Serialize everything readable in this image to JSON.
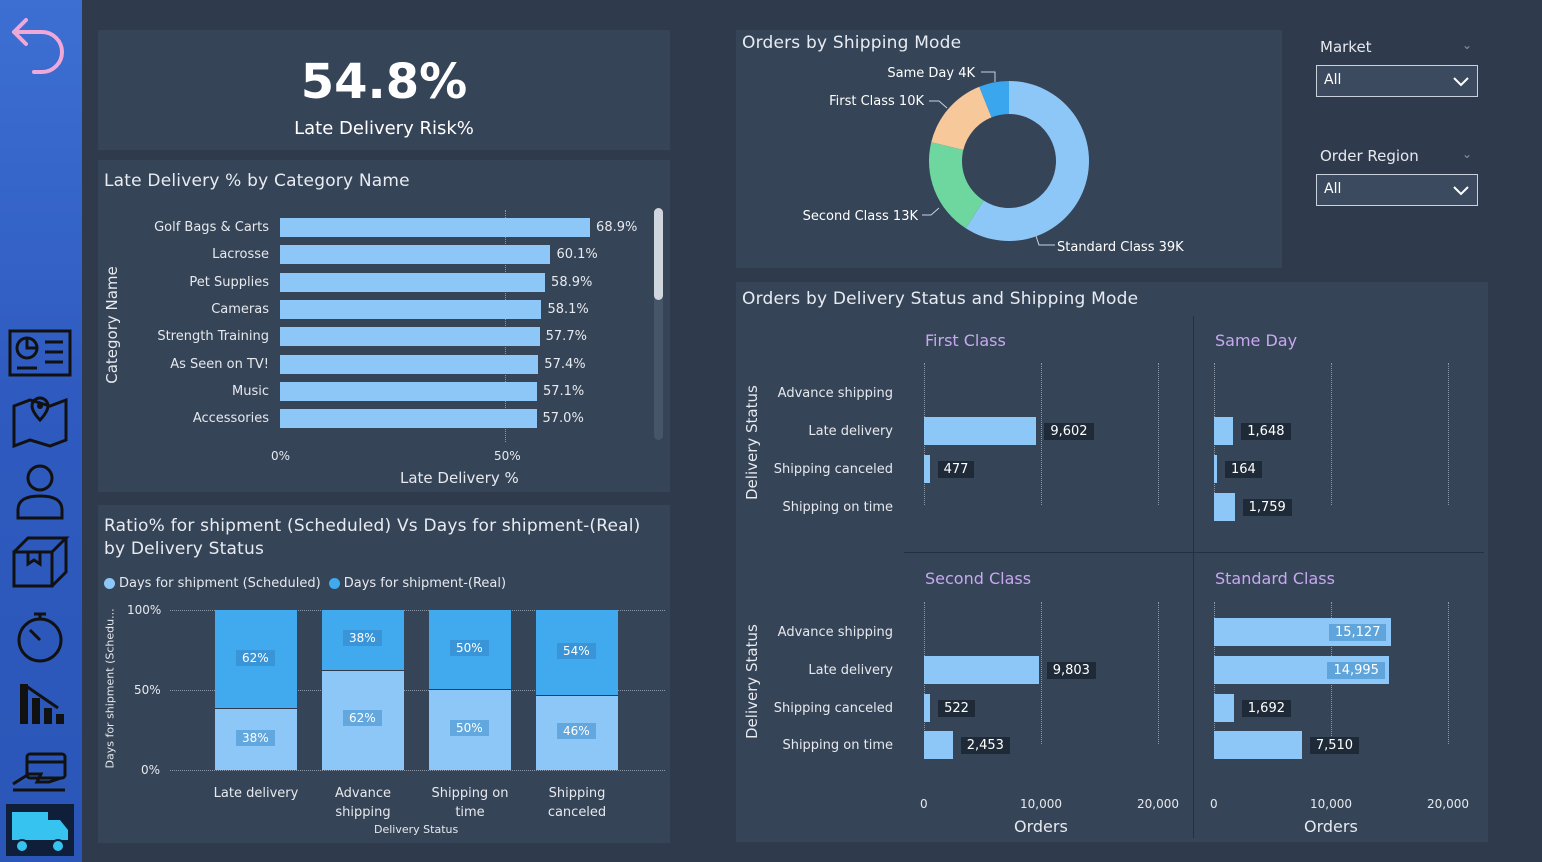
{
  "kpi": {
    "value": "54.8%",
    "label": "Late Delivery Risk%"
  },
  "category_chart": {
    "title": "Late Delivery % by Category Name",
    "y_axis_label": "Category Name",
    "x_axis_label": "Late Delivery %",
    "ticks": [
      "0%",
      "50%"
    ],
    "rows": [
      {
        "name": "Golf Bags & Carts",
        "value": 68.9,
        "label": "68.9%"
      },
      {
        "name": "Lacrosse",
        "value": 60.1,
        "label": "60.1%"
      },
      {
        "name": "Pet Supplies",
        "value": 58.9,
        "label": "58.9%"
      },
      {
        "name": "Cameras",
        "value": 58.1,
        "label": "58.1%"
      },
      {
        "name": "Strength Training",
        "value": 57.7,
        "label": "57.7%"
      },
      {
        "name": "As Seen on  TV!",
        "value": 57.4,
        "label": "57.4%"
      },
      {
        "name": "Music",
        "value": 57.1,
        "label": "57.1%"
      },
      {
        "name": "Accessories",
        "value": 57.0,
        "label": "57.0%"
      }
    ]
  },
  "ratio_chart": {
    "title_line1": "Ratio% for shipment (Scheduled) Vs Days for shipment-(Real)",
    "title_line2": "by Delivery Status",
    "legend": [
      {
        "name": "Days for shipment (Scheduled)",
        "color": "#8dc7f7"
      },
      {
        "name": "Days for shipment-(Real)",
        "color": "#41a9ee"
      }
    ],
    "y_axis_label": "Days for shipment (Schedu...",
    "x_axis_label": "Delivery Status",
    "y_ticks": [
      "100%",
      "50%",
      "0%"
    ],
    "columns": [
      {
        "line1": "Late delivery",
        "line2": "",
        "scheduled": 38,
        "real": 62,
        "scheduled_label": "38%",
        "real_label": "62%"
      },
      {
        "line1": "Advance",
        "line2": "shipping",
        "scheduled": 62,
        "real": 38,
        "scheduled_label": "62%",
        "real_label": "38%"
      },
      {
        "line1": "Shipping on",
        "line2": "time",
        "scheduled": 50,
        "real": 50,
        "scheduled_label": "50%",
        "real_label": "50%"
      },
      {
        "line1": "Shipping",
        "line2": "canceled",
        "scheduled": 46,
        "real": 54,
        "scheduled_label": "46%",
        "real_label": "54%"
      }
    ]
  },
  "donut": {
    "title": "Orders by Shipping Mode",
    "slices": [
      {
        "name": "Standard Class 39K",
        "value": 39,
        "color": "#8dc7f7"
      },
      {
        "name": "Second Class 13K",
        "value": 13,
        "color": "#6ed7a0"
      },
      {
        "name": "First Class 10K",
        "value": 10,
        "color": "#f7c89a"
      },
      {
        "name": "Same Day 4K",
        "value": 4,
        "color": "#3aa6ee"
      }
    ]
  },
  "slicers": {
    "market": {
      "label": "Market",
      "value": "All"
    },
    "region": {
      "label": "Order Region",
      "value": "All"
    }
  },
  "small_multiples": {
    "title": "Orders by Delivery Status and Shipping Mode",
    "y_axis_label": "Delivery Status",
    "x_axis_label": "Orders",
    "x_ticks": [
      "0",
      "10,000",
      "20,000"
    ],
    "x_max": 20000,
    "statuses": [
      "Advance shipping",
      "Late delivery",
      "Shipping canceled",
      "Shipping on time"
    ],
    "panels": [
      {
        "mode": "First Class",
        "values": [
          0,
          9602,
          477,
          0
        ],
        "labels": [
          "",
          "9,602",
          "477",
          ""
        ]
      },
      {
        "mode": "Same Day",
        "values": [
          0,
          1648,
          164,
          1759
        ],
        "labels": [
          "",
          "1,648",
          "164",
          "1,759"
        ]
      },
      {
        "mode": "Second Class",
        "values": [
          0,
          9803,
          522,
          2453
        ],
        "labels": [
          "",
          "9,803",
          "522",
          "2,453"
        ]
      },
      {
        "mode": "Standard Class",
        "values": [
          15127,
          14995,
          1692,
          7510
        ],
        "labels": [
          "15,127",
          "14,995",
          "1,692",
          "7,510"
        ]
      }
    ]
  },
  "chart_data": [
    {
      "type": "bar",
      "title": "Late Delivery % by Category Name",
      "categories": [
        "Golf Bags & Carts",
        "Lacrosse",
        "Pet Supplies",
        "Cameras",
        "Strength Training",
        "As Seen on  TV!",
        "Music",
        "Accessories"
      ],
      "values": [
        68.9,
        60.1,
        58.9,
        58.1,
        57.7,
        57.4,
        57.1,
        57.0
      ],
      "xlabel": "Late Delivery %",
      "ylabel": "Category Name"
    },
    {
      "type": "bar",
      "title": "Ratio% for shipment (Scheduled) Vs Days for shipment-(Real) by Delivery Status",
      "categories": [
        "Late delivery",
        "Advance shipping",
        "Shipping on time",
        "Shipping canceled"
      ],
      "series": [
        {
          "name": "Days for shipment (Scheduled)",
          "values": [
            38,
            62,
            50,
            46
          ]
        },
        {
          "name": "Days for shipment-(Real)",
          "values": [
            62,
            38,
            50,
            54
          ]
        }
      ],
      "xlabel": "Delivery Status",
      "ylim": [
        0,
        100
      ]
    },
    {
      "type": "pie",
      "title": "Orders by Shipping Mode",
      "categories": [
        "Standard Class",
        "Second Class",
        "First Class",
        "Same Day"
      ],
      "values": [
        39000,
        13000,
        10000,
        4000
      ]
    },
    {
      "type": "bar",
      "title": "Orders by Delivery Status and Shipping Mode",
      "categories": [
        "Advance shipping",
        "Late delivery",
        "Shipping canceled",
        "Shipping on time"
      ],
      "series": [
        {
          "name": "First Class",
          "values": [
            0,
            9602,
            477,
            0
          ]
        },
        {
          "name": "Same Day",
          "values": [
            0,
            1648,
            164,
            1759
          ]
        },
        {
          "name": "Second Class",
          "values": [
            0,
            9803,
            522,
            2453
          ]
        },
        {
          "name": "Standard Class",
          "values": [
            15127,
            14995,
            1692,
            7510
          ]
        }
      ],
      "xlabel": "Orders",
      "ylabel": "Delivery Status"
    }
  ]
}
